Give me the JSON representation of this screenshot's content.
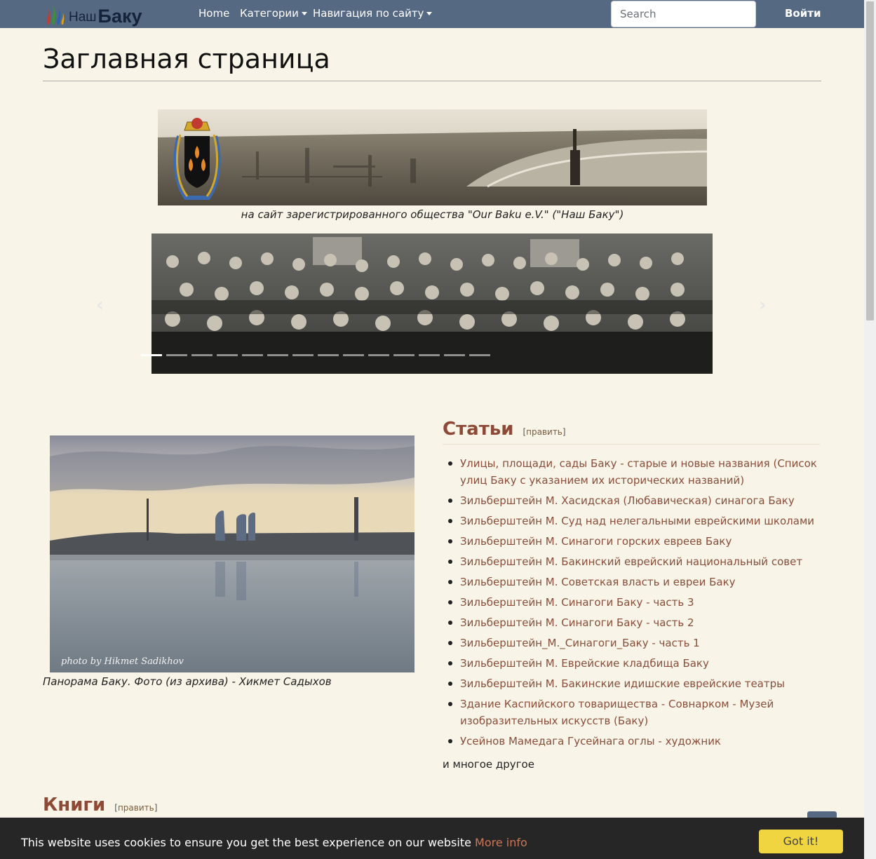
{
  "nav": {
    "logo_small": "Наш",
    "logo_big": "Баку",
    "home": "Home",
    "categories": "Категории",
    "site_nav": "Навигация по сайту",
    "search_placeholder": "Search",
    "login": "Войти"
  },
  "page": {
    "title": "Заглавная страница"
  },
  "banner": {
    "caption": "на сайт зарегистрированного общества \"Our Baku e.V.\" (\"Наш Баку\")"
  },
  "carousel": {
    "prev": "‹",
    "next": "›",
    "slide_count": 14,
    "active_index": 0
  },
  "panorama": {
    "watermark": "photo by Hikmet Sadikhov",
    "caption": "Панорама Баку. Фото (из архива) - Хикмет Садыхов"
  },
  "articles": {
    "heading": "Статьи",
    "edit_label": "править",
    "items": [
      "Улицы, площади, сады Баку - старые и новые названия (Список улиц Баку с указанием их исторических названий)",
      "Зильберштейн М. Хасидская (Любавическая) синагога Баку",
      "Зильберштейн М. Суд над нелегальными еврейскими школами",
      "Зильберштейн М. Синагоги горских евреев Баку",
      "Зильберштейн М. Бакинский еврейский национальный совет",
      "Зильберштейн М. Советская власть и евреи Баку",
      "Зильберштейн М. Синагоги Баку - часть 3",
      "Зильберштейн М. Синагоги Баку - часть 2",
      "Зильберштейн_М._Синагоги_Баку - часть 1",
      "Зильберштейн М. Еврейские кладбища Баку",
      "Зильберштейн М. Бакинские идишские еврейские театры",
      "Здание Каспийского товарищества - Совнарком - Музей изобразительных искусств (Баку)",
      "Усейнов Мамедага Гусейнага оглы - художник"
    ],
    "more": "и многое другое"
  },
  "books": {
    "heading": "Книги",
    "edit_label": "править"
  },
  "cookie": {
    "text": "This website uses cookies to ensure you get the best experience on our website",
    "more_info": "More info",
    "button": "Got it!"
  },
  "colors": {
    "navbar": "#566983",
    "background": "#f8f4e7",
    "link": "#8a4e3a",
    "heading": "#8e4a36",
    "cookie_button": "#f1d540"
  }
}
